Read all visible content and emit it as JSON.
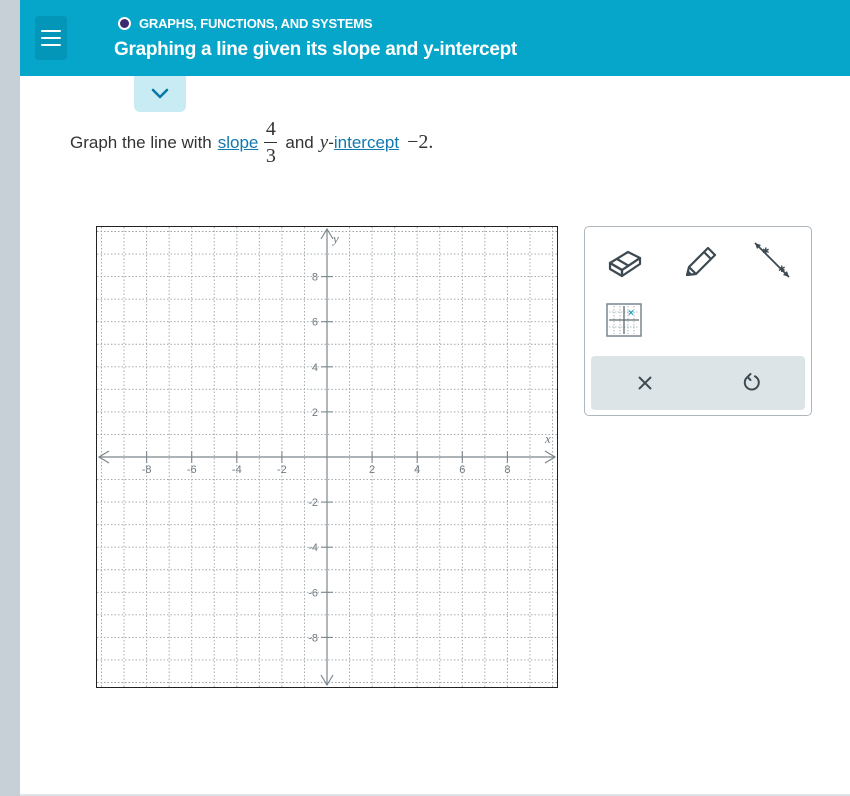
{
  "header": {
    "topic": "GRAPHS, FUNCTIONS, AND SYSTEMS",
    "title": "Graphing a line given its slope and y-intercept"
  },
  "question": {
    "prefix": "Graph the line with",
    "slope_link": "slope",
    "slope_numerator": "4",
    "slope_denominator": "3",
    "and_text": "and",
    "y_var": "y",
    "hyphen": "-",
    "intercept_link": "intercept",
    "intercept_value": "−2."
  },
  "graph": {
    "x_axis_label": "x",
    "y_axis_label": "y",
    "x_range": [
      -10,
      10
    ],
    "y_range": [
      -10,
      10
    ],
    "x_tick_labels": [
      "-8",
      "-6",
      "-4",
      "-2",
      "2",
      "4",
      "6",
      "8"
    ],
    "y_tick_labels": [
      "8",
      "6",
      "4",
      "2",
      "-2",
      "-4",
      "-6",
      "-8"
    ],
    "grid": "dotted"
  },
  "toolbox": {
    "tools": [
      "eraser-icon",
      "pencil-icon",
      "line-tool-icon",
      "point-grid-icon"
    ],
    "actions": [
      "close-icon",
      "undo-icon"
    ]
  },
  "colors": {
    "header_bg": "#05a6c9",
    "link": "#1179b0",
    "grid_axis": "#9aa3a8"
  }
}
